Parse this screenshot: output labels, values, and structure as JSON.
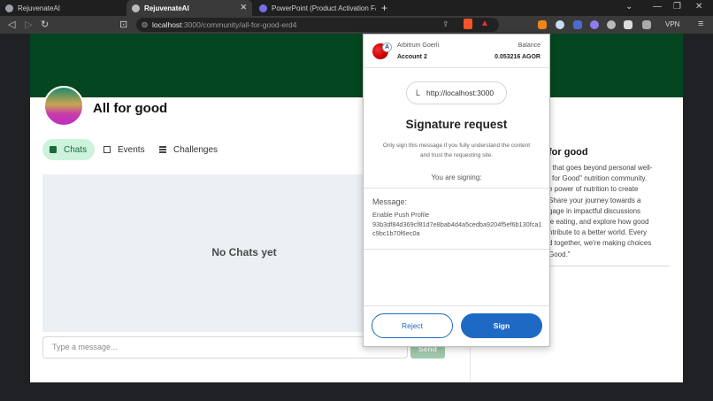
{
  "browser": {
    "tabs": [
      {
        "label": "RejuvenateAI",
        "active": false
      },
      {
        "label": "RejuvenateAI",
        "active": true
      },
      {
        "label": "PowerPoint (Product Activation Failed)",
        "active": false
      }
    ],
    "url_host": "localhost",
    "url_path": ":3000/community/all-for-good-erd4",
    "vpn_label": "VPN"
  },
  "page": {
    "title": "All for good",
    "tabs": [
      {
        "label": "Chats",
        "active": true,
        "icon": "chat-icon"
      },
      {
        "label": "Events",
        "active": false,
        "icon": "calendar-icon"
      },
      {
        "label": "Challenges",
        "active": false,
        "icon": "list-icon"
      }
    ],
    "empty_chats": "No Chats yet",
    "message_placeholder": "Type a message...",
    "send_label": "Send",
    "side_heading": "for good",
    "side_text": "t that goes beyond personal well-\nl for Good\" nutrition community.\ne power of nutrition to create\nShare your journey towards a\ngage in impactful discussions\nle eating, and explore how good\nntribute to a better world. Every\nd together, we're making choices\nGood.\""
  },
  "popup": {
    "network": "Arbitrum Goerli",
    "account": "Account 2",
    "balance_label": "Balance",
    "balance_value": "0.053216 AGOR",
    "origin_initial": "L",
    "origin": "http://localhost:3000",
    "title": "Signature request",
    "warning": "Only sign this message if you fully understand the content and trust the requesting site.",
    "signing_label": "You are signing:",
    "message_label": "Message:",
    "message_text": "Enable Push Profile\n93b3df84d369cf81d7e8bab4d4a5cedba9204f5ef6b130fca1c9bc1b70f6ec0a",
    "reject_label": "Reject",
    "sign_label": "Sign"
  },
  "colors": {
    "banner": "#04461f",
    "active_tab_bg": "#cdf3dc",
    "primary_blue": "#1e69c4",
    "send_button": "#a0c8ab"
  }
}
